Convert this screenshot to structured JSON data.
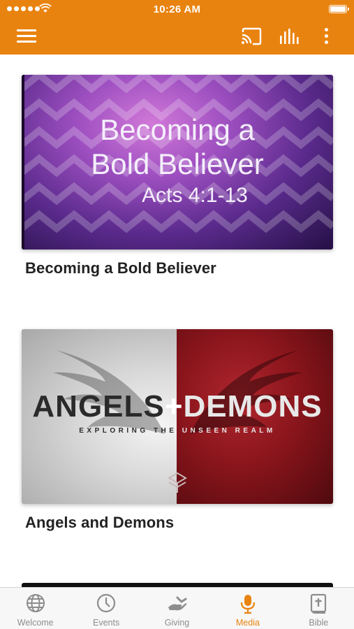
{
  "status_bar": {
    "time": "10:26 AM"
  },
  "header": {
    "background_color": "#e9830f",
    "icons": [
      "menu-icon",
      "cast-icon",
      "equalizer-icon",
      "more-vertical-icon"
    ]
  },
  "media_list": [
    {
      "title": "Becoming a Bold Believer",
      "thumbnail": {
        "line1": "Becoming a",
        "line2": "Bold Believer",
        "line3": "Acts 4:1-13"
      }
    },
    {
      "title": "Angels and Demons",
      "thumbnail": {
        "word_left": "ANGELS",
        "plus": "+",
        "word_right": "DEMONS",
        "subtitle_left": "EXPLORING THE ",
        "subtitle_right": "UNSEEN REALM"
      }
    }
  ],
  "tab_bar": {
    "active_color": "#e9830f",
    "inactive_color": "#8d8d8d",
    "tabs": [
      {
        "label": "Welcome",
        "icon": "globe-icon",
        "active": false
      },
      {
        "label": "Events",
        "icon": "clock-icon",
        "active": false
      },
      {
        "label": "Giving",
        "icon": "giving-hand-icon",
        "active": false
      },
      {
        "label": "Media",
        "icon": "microphone-icon",
        "active": true
      },
      {
        "label": "Bible",
        "icon": "bible-icon",
        "active": false
      }
    ]
  }
}
